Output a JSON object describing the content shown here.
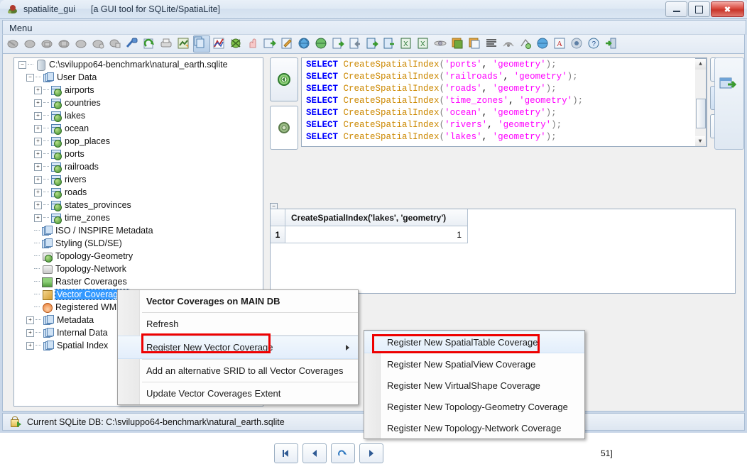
{
  "window": {
    "app_name": "spatialite_gui",
    "subtitle": "[a GUI tool for SQLite/SpatiaLite]",
    "ghost_text": "",
    "icon": "spatialite-logo-icon",
    "minimize_label": "–",
    "maximize_label": "□",
    "close_label": "✖"
  },
  "menubar": {
    "items": [
      {
        "label": "Menu",
        "name": "menu"
      }
    ]
  },
  "toolbar": {
    "icons": [
      {
        "name": "connect-db-icon",
        "tip": "Connecting an existing SQLite DB"
      },
      {
        "name": "create-db-icon",
        "tip": "Creating a new (empty) SQLite DB"
      },
      {
        "name": "close-db-icon",
        "tip": "Closing current SQLite DB"
      },
      {
        "name": "save-db-icon",
        "tip": "Saving current SQLite DB"
      },
      {
        "name": "memory-db-icon",
        "tip": "Memory DB"
      },
      {
        "name": "attach-db-icon",
        "tip": "Attaching a further DB"
      },
      {
        "name": "detach-db-icon",
        "tip": "Detaching DB"
      },
      {
        "name": "clean-db-icon",
        "tip": "Vacuum"
      },
      {
        "name": "refresh-icon",
        "tip": "Refresh"
      },
      {
        "name": "print-icon",
        "tip": "Print"
      },
      {
        "name": "sql-script-icon",
        "tip": "Execute SQL script"
      },
      {
        "name": "copy-icon",
        "tip": "Copy",
        "pressed": true
      },
      {
        "name": "chart-icon",
        "tip": "Charts"
      },
      {
        "name": "bug-icon",
        "tip": "Debug"
      },
      {
        "name": "hand-icon",
        "tip": "Pointer"
      },
      {
        "name": "import-icon",
        "tip": "Import"
      },
      {
        "name": "edit-icon",
        "tip": "Edit"
      },
      {
        "name": "globe-icon",
        "tip": "Network"
      },
      {
        "name": "globe-web-icon",
        "tip": "WFS"
      },
      {
        "name": "load-shapefile-icon",
        "tip": "Load Shapefile"
      },
      {
        "name": "dump-shapefile-icon",
        "tip": "Dump Shapefile"
      },
      {
        "name": "load-txt-icon",
        "tip": "Load text"
      },
      {
        "name": "dump-txt-icon",
        "tip": "Dump text"
      },
      {
        "name": "load-xls-icon",
        "tip": "Load XLS"
      },
      {
        "name": "dump-xls-icon",
        "tip": "Dump XLS"
      },
      {
        "name": "link-icon",
        "tip": "Virtual link"
      },
      {
        "name": "layers-icon",
        "tip": "Layers"
      },
      {
        "name": "copy-layers-icon",
        "tip": "Duplicate layer"
      },
      {
        "name": "text-lines-icon",
        "tip": "Query log"
      },
      {
        "name": "wms-icon",
        "tip": "WMS"
      },
      {
        "name": "topology-icon",
        "tip": "Topology"
      },
      {
        "name": "srid-globe-icon",
        "tip": "SRID"
      },
      {
        "name": "font-icon",
        "tip": "Fonts"
      },
      {
        "name": "about-icon",
        "tip": "About"
      },
      {
        "name": "help-icon",
        "tip": "Help"
      },
      {
        "name": "exit-icon",
        "tip": "Exit"
      }
    ]
  },
  "tree": {
    "root": {
      "label": "C:\\sviluppo64-benchmark\\natural_earth.sqlite",
      "icon": "database-icon",
      "expander": "−"
    },
    "user_data": {
      "label": "User Data",
      "icon": "pages-icon",
      "expander": "−"
    },
    "tables": [
      {
        "label": "airports",
        "icon": "table-geometry-icon",
        "expander": "+"
      },
      {
        "label": "countries",
        "icon": "table-geometry-icon",
        "expander": "+"
      },
      {
        "label": "lakes",
        "icon": "table-geometry-icon",
        "expander": "+"
      },
      {
        "label": "ocean",
        "icon": "table-geometry-icon",
        "expander": "+"
      },
      {
        "label": "pop_places",
        "icon": "table-geometry-icon",
        "expander": "+"
      },
      {
        "label": "ports",
        "icon": "table-geometry-icon",
        "expander": "+"
      },
      {
        "label": "railroads",
        "icon": "table-geometry-icon",
        "expander": "+"
      },
      {
        "label": "rivers",
        "icon": "table-geometry-icon",
        "expander": "+"
      },
      {
        "label": "roads",
        "icon": "table-geometry-icon",
        "expander": "+"
      },
      {
        "label": "states_provinces",
        "icon": "table-geometry-icon",
        "expander": "+"
      },
      {
        "label": "time_zones",
        "icon": "table-geometry-icon",
        "expander": "+"
      }
    ],
    "sections": [
      {
        "label": "ISO / INSPIRE Metadata",
        "icon": "pages-icon",
        "expander": ""
      },
      {
        "label": "Styling (SLD/SE)",
        "icon": "pages-icon",
        "expander": ""
      },
      {
        "label": "Topology-Geometry",
        "icon": "topology-geometry-icon",
        "expander": ""
      },
      {
        "label": "Topology-Network",
        "icon": "topology-network-icon",
        "expander": ""
      },
      {
        "label": "Raster Coverages",
        "icon": "raster-coverages-icon",
        "expander": ""
      },
      {
        "label": "Vector Coverages",
        "icon": "vector-coverages-icon",
        "expander": "",
        "selected": true
      },
      {
        "label": "Registered WMS",
        "icon": "wms-icon",
        "expander": ""
      },
      {
        "label": "Metadata",
        "icon": "pages-icon",
        "expander": "+"
      },
      {
        "label": "Internal Data",
        "icon": "pages-icon",
        "expander": "+"
      },
      {
        "label": "Spatial Index",
        "icon": "pages-icon",
        "expander": "+"
      }
    ]
  },
  "sql": {
    "run_button": "execute-sql-button",
    "step_button": "execute-step-button",
    "lines": [
      {
        "kw": "SELECT",
        "fn": "CreateSpatialIndex",
        "args": "'ports', 'geometry'"
      },
      {
        "kw": "SELECT",
        "fn": "CreateSpatialIndex",
        "args": "'railroads', 'geometry'"
      },
      {
        "kw": "SELECT",
        "fn": "CreateSpatialIndex",
        "args": "'roads', 'geometry'"
      },
      {
        "kw": "SELECT",
        "fn": "CreateSpatialIndex",
        "args": "'time_zones', 'geometry'"
      },
      {
        "kw": "SELECT",
        "fn": "CreateSpatialIndex",
        "args": "'ocean', 'geometry'"
      },
      {
        "kw": "SELECT",
        "fn": "CreateSpatialIndex",
        "args": "'rivers', 'geometry'"
      },
      {
        "kw": "SELECT",
        "fn": "CreateSpatialIndex",
        "args": "'lakes', 'geometry'"
      }
    ],
    "scroll_up": "▲",
    "scroll_down": "▼",
    "side_buttons": [
      {
        "name": "filter-button",
        "icon": "funnel-icon"
      },
      {
        "name": "refresh-query-button",
        "icon": "refresh-page-icon"
      },
      {
        "name": "stop-query-button",
        "icon": "cancel-icon"
      }
    ],
    "export_button": {
      "name": "export-button",
      "icon": "export-window-icon"
    }
  },
  "grid": {
    "columns": [
      "CreateSpatialIndex('lakes', 'geometry')"
    ],
    "rows": [
      {
        "num": "1",
        "cells": [
          "1"
        ]
      }
    ]
  },
  "navbar": {
    "buttons": [
      {
        "name": "first-row-button",
        "icon": "first-icon"
      },
      {
        "name": "previous-row-button",
        "icon": "prev-icon"
      },
      {
        "name": "refresh-rows-button",
        "icon": "refresh-icon"
      },
      {
        "name": "next-row-button",
        "icon": "next-icon"
      }
    ],
    "status": "51]"
  },
  "context_menu": {
    "title": "Vector Coverages on MAIN DB",
    "items": [
      {
        "label": "Refresh",
        "name": "menu-refresh",
        "submenu": false
      },
      {
        "label": "Register New Vector Coverage",
        "name": "menu-register-new-vector-coverage",
        "submenu": true,
        "highlighted": true
      },
      {
        "label": "Add an alternative SRID to all Vector Coverages",
        "name": "menu-add-alternative-srid",
        "submenu": false
      },
      {
        "label": "Update Vector Coverages Extent",
        "name": "menu-update-vector-coverages-extent",
        "submenu": false
      }
    ]
  },
  "submenu": {
    "items": [
      {
        "label": "Register New SpatialTable Coverage",
        "name": "submenu-register-spatialtable",
        "highlighted": true
      },
      {
        "label": "Register New SpatialView Coverage",
        "name": "submenu-register-spatialview"
      },
      {
        "label": "Register New VirtualShape Coverage",
        "name": "submenu-register-virtualshape"
      },
      {
        "label": "Register New Topology-Geometry Coverage",
        "name": "submenu-register-topology-geometry"
      },
      {
        "label": "Register New Topology-Network Coverage",
        "name": "submenu-register-topology-network"
      }
    ]
  },
  "statusbar": {
    "icon": "db-lock-icon",
    "text": "Current SQLite DB: C:\\sviluppo64-benchmark\\natural_earth.sqlite"
  },
  "colors": {
    "keyword": "#0000ff",
    "function": "#cc8800",
    "string": "#ff00ff",
    "selection": "#3399ff",
    "annotation": "#ee0000"
  }
}
